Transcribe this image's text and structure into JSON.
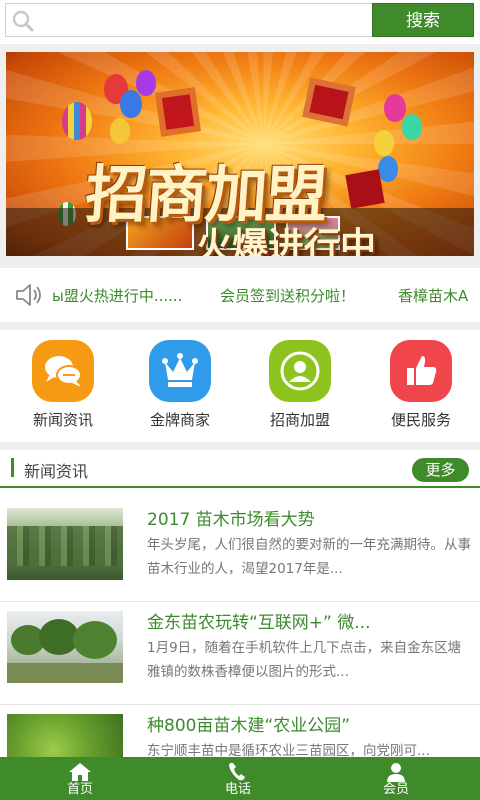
{
  "search": {
    "placeholder": "",
    "button_label": "搜索"
  },
  "banner": {
    "title": "招商加盟",
    "subtitle": "火爆进行中"
  },
  "marquee": {
    "items": [
      "ы盟火热进行中......",
      "会员签到送积分啦！",
      "香樟苗木A"
    ]
  },
  "quicknav": {
    "items": [
      {
        "label": "新闻资讯",
        "icon": "chat-bubbles-icon",
        "color": "#f59a12"
      },
      {
        "label": "金牌商家",
        "icon": "crown-icon",
        "color": "#2f9bea"
      },
      {
        "label": "招商加盟",
        "icon": "user-circle-icon",
        "color": "#8cc31d"
      },
      {
        "label": "便民服务",
        "icon": "thumbs-up-icon",
        "color": "#f0454b"
      }
    ]
  },
  "news": {
    "header": "新闻资讯",
    "more_label": "更多",
    "items": [
      {
        "title": "2017 苗木市场看大势",
        "desc": "年头岁尾，人们很自然的要对新的一年充满期待。从事苗木行业的人，渴望2017年是..."
      },
      {
        "title": "金东苗农玩转“互联网+” 微...",
        "desc": "1月9日，随着在手机软件上几下点击，来自金东区塘雅镇的数株香樟便以图片的形式..."
      },
      {
        "title": "种800亩苗木建“农业公园”",
        "desc": "东宁顺丰苗中是循环农业三苗园区，向党刚可..."
      }
    ]
  },
  "bottombar": {
    "items": [
      {
        "label": "首页",
        "icon": "home-icon"
      },
      {
        "label": "电话",
        "icon": "phone-icon"
      },
      {
        "label": "会员",
        "icon": "member-icon"
      }
    ]
  },
  "colors": {
    "accent": "#3f8a2a",
    "link": "#3c8a2e"
  }
}
